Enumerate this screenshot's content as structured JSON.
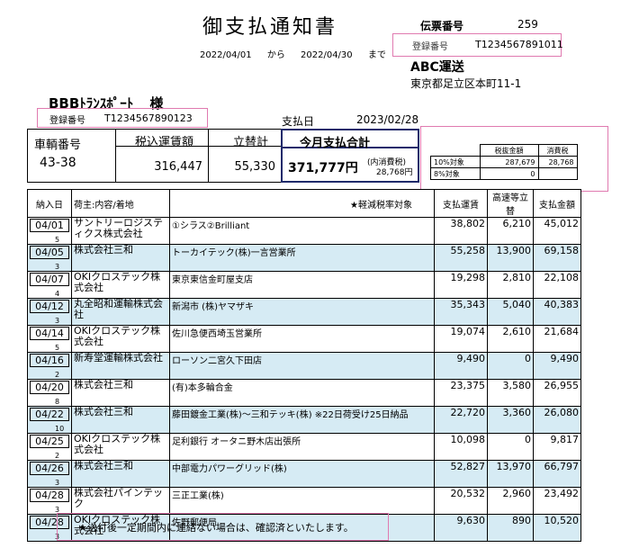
{
  "doc_title": "御支払通知書",
  "period": {
    "from": "2022/04/01",
    "from_word": "から",
    "to": "2022/04/30",
    "to_word": "まで"
  },
  "slip": {
    "label": "伝票番号",
    "number": "259"
  },
  "issuer": {
    "reg_label": "登録番号",
    "reg_number": "T1234567891011",
    "company": "ABC運送",
    "address": "東京都足立区本町11-1"
  },
  "recipient": {
    "name": "BBBﾄﾗﾝｽﾎﾟｰﾄ",
    "honorific": "様",
    "reg_label": "登録番号",
    "reg_number": "T1234567890123"
  },
  "payment_date": {
    "label": "支払日",
    "value": "2023/02/28"
  },
  "summary": {
    "vehicle_label": "車輌番号",
    "vehicle_no": "43-38",
    "fare_label": "税込運賃額",
    "fare": "316,447",
    "advance_label": "立替計",
    "advance": "55,330",
    "total_label": "今月支払合計",
    "total": "371,777円",
    "tax_note": "(内消費税)",
    "tax_amount": "28,768円"
  },
  "tax_table": {
    "head_base": "税抜金額",
    "head_tax": "消費税",
    "rows": [
      {
        "label": "10%対象",
        "base": "287,679",
        "tax": "28,768"
      },
      {
        "label": "8%対象",
        "base": "0",
        "tax": ""
      }
    ]
  },
  "table": {
    "headers": {
      "date": "納入日",
      "shipper": "荷主:内容/着地",
      "reduced": "★軽減税率対象",
      "fare": "支払運賃",
      "toll": "高速等立替",
      "amount": "支払金額"
    },
    "rows": [
      {
        "date": "04/01",
        "idx": "5",
        "shipper": "サントリーロジスティクス株式会社",
        "dest": "①シラス②Brilliant",
        "fare": "38,802",
        "toll": "6,210",
        "amount": "45,012"
      },
      {
        "date": "04/05",
        "idx": "3",
        "shipper": "株式会社三和",
        "dest": "トーカイテック(株)一言営業所",
        "fare": "55,258",
        "toll": "13,900",
        "amount": "69,158"
      },
      {
        "date": "04/07",
        "idx": "4",
        "shipper": "OKIクロステック株式会社",
        "dest": "東京東信金町屋支店",
        "fare": "19,298",
        "toll": "2,810",
        "amount": "22,108"
      },
      {
        "date": "04/12",
        "idx": "3",
        "shipper": "丸全昭和運輸株式会社",
        "dest": "新潟市 (株)ヤマザキ",
        "fare": "35,343",
        "toll": "5,040",
        "amount": "40,383"
      },
      {
        "date": "04/14",
        "idx": "5",
        "shipper": "OKIクロステック株式会社",
        "dest": "佐川急便西埼玉営業所",
        "fare": "19,074",
        "toll": "2,610",
        "amount": "21,684"
      },
      {
        "date": "04/16",
        "idx": "2",
        "shipper": "新寿堂運輸株式会社",
        "dest": "ローソン二宮久下田店",
        "fare": "9,490",
        "toll": "0",
        "amount": "9,490"
      },
      {
        "date": "04/20",
        "idx": "8",
        "shipper": "株式会社三和",
        "dest": "(有)本多輪合金",
        "fare": "23,375",
        "toll": "3,580",
        "amount": "26,955"
      },
      {
        "date": "04/22",
        "idx": "10",
        "shipper": "株式会社三和",
        "dest": "藤田鍍金工業(株)～三和テッキ(株) ※22日荷受け25日納品",
        "fare": "22,720",
        "toll": "3,360",
        "amount": "26,080"
      },
      {
        "date": "04/25",
        "idx": "2",
        "shipper": "OKIクロステック株式会社",
        "dest": "足利銀行 オータニ野木店出張所",
        "fare": "10,098",
        "toll": "0",
        "amount": "9,817"
      },
      {
        "date": "04/26",
        "idx": "3",
        "shipper": "株式会社三和",
        "dest": "中部電力パワーグリッド(株)",
        "fare": "52,827",
        "toll": "13,970",
        "amount": "66,797"
      },
      {
        "date": "04/28",
        "idx": "3",
        "shipper": "株式会社パインテック",
        "dest": "三正工業(株)",
        "fare": "20,532",
        "toll": "2,960",
        "amount": "23,492"
      },
      {
        "date": "04/28",
        "idx": "3",
        "shipper": "OKIクロステック株式会社",
        "dest": "佐野郵便局",
        "fare": "9,630",
        "toll": "890",
        "amount": "10,520"
      }
    ]
  },
  "footer_note": "★送付後一定期間内に連絡ない場合は、確認済といたします。",
  "colors": {
    "shade": "#d6ebf4",
    "highlight_border": "#e07ab0",
    "total_border": "#1f2a6b"
  }
}
